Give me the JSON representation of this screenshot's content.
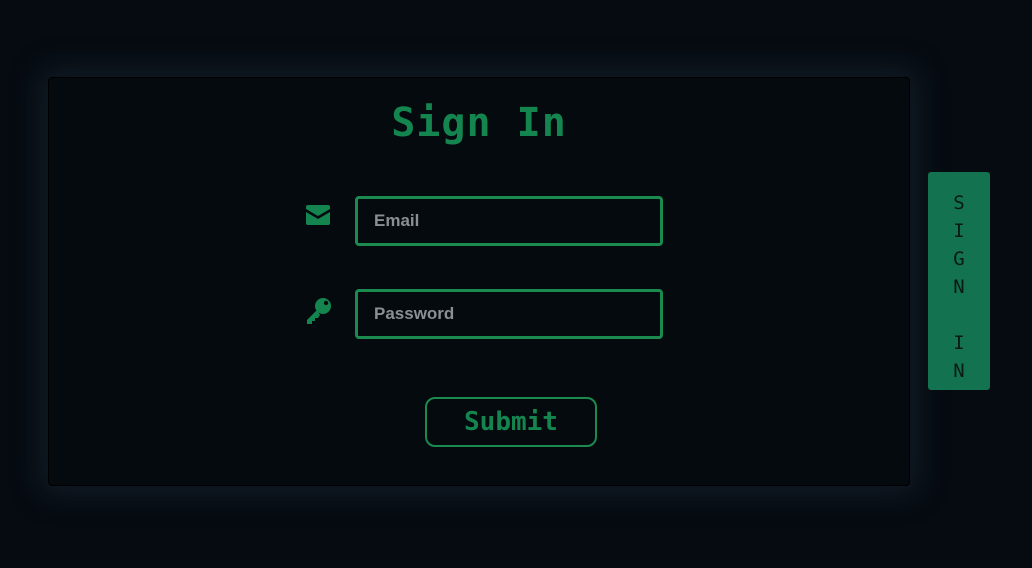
{
  "form": {
    "title": "Sign In",
    "email": {
      "icon": "envelope-icon",
      "placeholder": "Email",
      "value": ""
    },
    "password": {
      "icon": "key-icon",
      "placeholder": "Password",
      "value": ""
    },
    "submit_label": "Submit"
  },
  "side_tab": {
    "label": "SIGN IN"
  },
  "colors": {
    "background": "#060b11",
    "panel": "#050a0f",
    "accent": "#1a8a4f",
    "tab": "#137250"
  }
}
